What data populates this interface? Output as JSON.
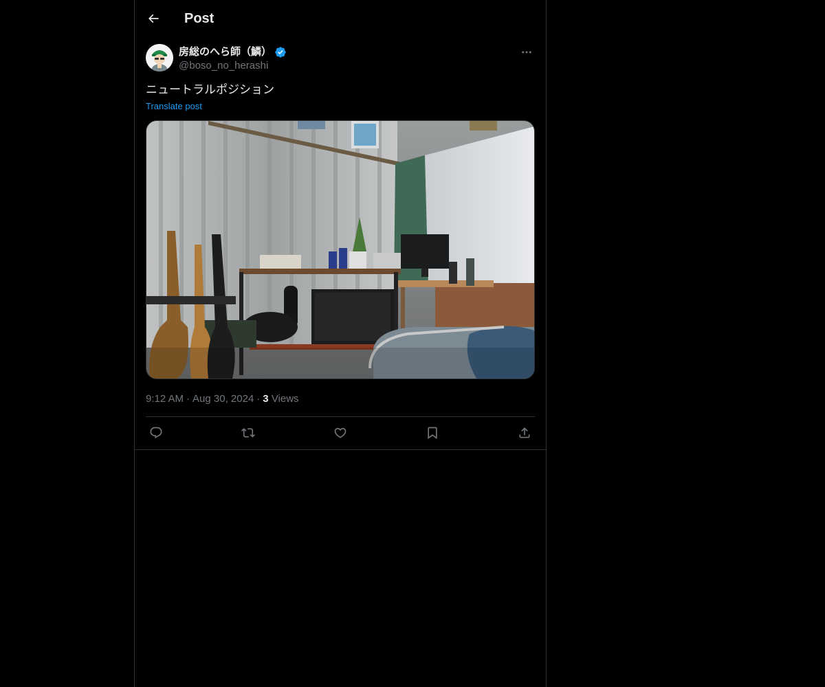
{
  "header": {
    "title": "Post",
    "back_icon": "arrow-left-icon"
  },
  "post": {
    "author_name": "房総のへら師（鱗）",
    "author_handle": "@boso_no_herashi",
    "verified": true,
    "text": "ニュートラルポジション",
    "translate_label": "Translate post",
    "time": "9:12 AM",
    "date": "Aug 30, 2024",
    "views_count": "3",
    "views_label": "Views",
    "separator": "·"
  },
  "actions": [
    {
      "name": "reply",
      "icon": "reply-icon"
    },
    {
      "name": "repost",
      "icon": "repost-icon"
    },
    {
      "name": "like",
      "icon": "heart-icon"
    },
    {
      "name": "bookmark",
      "icon": "bookmark-icon"
    },
    {
      "name": "share",
      "icon": "share-icon"
    }
  ],
  "colors": {
    "background": "#000000",
    "text": "#e7e9ea",
    "secondary_text": "#71767b",
    "accent": "#1d9bf0",
    "border": "#2f3336"
  }
}
